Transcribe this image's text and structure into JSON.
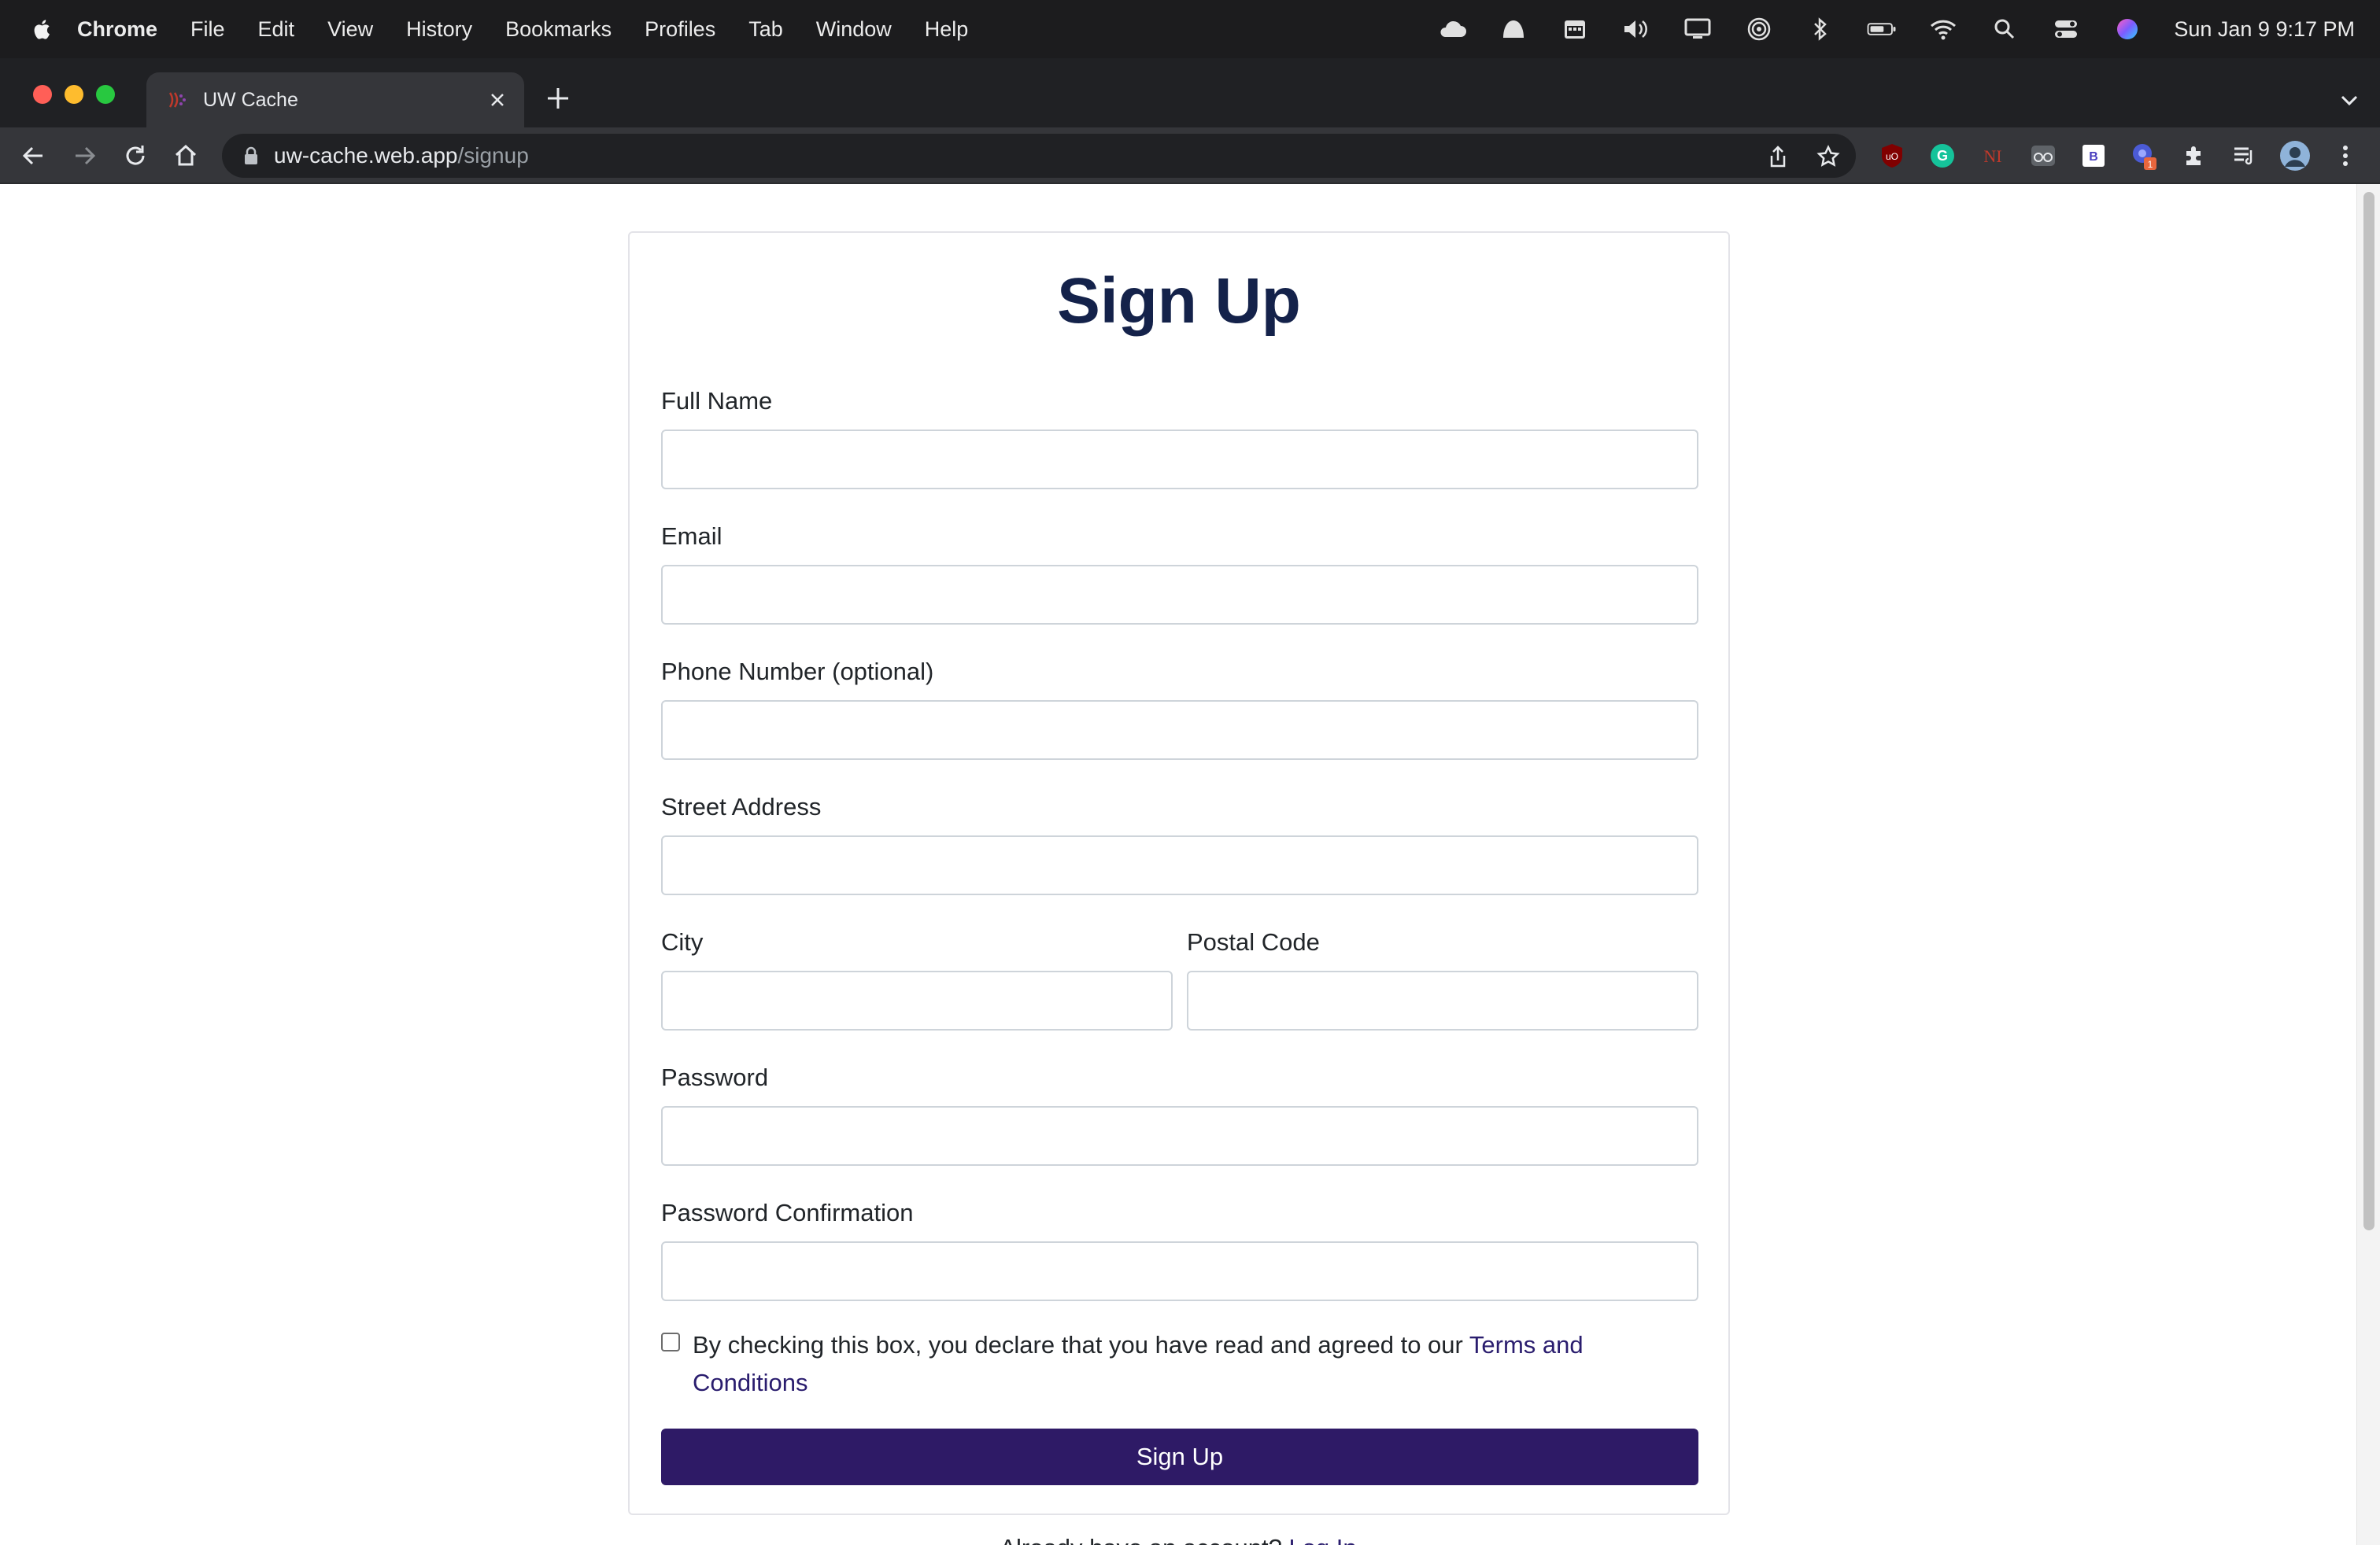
{
  "menubar": {
    "app": "Chrome",
    "items": [
      "File",
      "Edit",
      "View",
      "History",
      "Bookmarks",
      "Profiles",
      "Tab",
      "Window",
      "Help"
    ],
    "clock": "Sun Jan 9  9:17 PM"
  },
  "browser": {
    "tab_title": "UW Cache",
    "url_host": "uw-cache.web.app",
    "url_path": "/signup",
    "extension_badge": "1"
  },
  "form": {
    "title": "Sign Up",
    "full_name_label": "Full Name",
    "email_label": "Email",
    "phone_label": "Phone Number (optional)",
    "street_label": "Street Address",
    "city_label": "City",
    "postal_label": "Postal Code",
    "password_label": "Password",
    "password_confirm_label": "Password Confirmation",
    "full_name_value": "",
    "email_value": "",
    "phone_value": "",
    "street_value": "",
    "city_value": "",
    "postal_value": "",
    "password_value": "",
    "password_confirm_value": "",
    "terms_text": "By checking this box, you declare that you have read and agreed to our ",
    "terms_link": "Terms and Conditions",
    "submit_label": "Sign Up"
  },
  "footer": {
    "prompt": "Already have an account? ",
    "login_link": "Log In"
  },
  "colors": {
    "primary": "#2e1a66",
    "title": "#14224a",
    "link": "#2a1d6e"
  }
}
